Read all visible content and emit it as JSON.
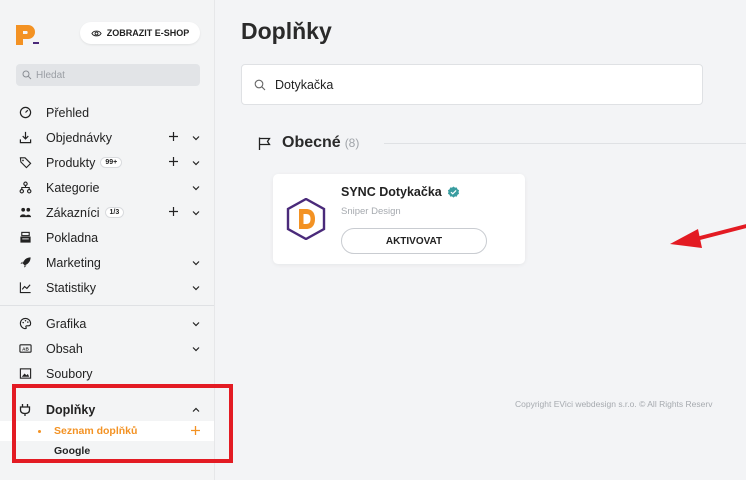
{
  "header": {
    "eshop_button": "ZOBRAZIT E-SHOP",
    "search_placeholder": "Hledat"
  },
  "sidebar": {
    "items": [
      {
        "label": "Přehled"
      },
      {
        "label": "Objednávky"
      },
      {
        "label": "Produkty",
        "badge": "99+"
      },
      {
        "label": "Kategorie"
      },
      {
        "label": "Zákazníci",
        "badge": "1/3"
      },
      {
        "label": "Pokladna"
      },
      {
        "label": "Marketing"
      },
      {
        "label": "Statistiky"
      },
      {
        "label": "Grafika"
      },
      {
        "label": "Obsah"
      },
      {
        "label": "Soubory"
      }
    ],
    "section": {
      "label": "Doplňky",
      "sub_items": [
        {
          "label": "Seznam doplňků"
        },
        {
          "label": "Google"
        }
      ]
    }
  },
  "main": {
    "title": "Doplňky",
    "search_value": "Dotykačka",
    "group": {
      "title": "Obecné",
      "count": "(8)"
    },
    "card": {
      "name": "SYNC Dotykačka",
      "vendor": "Sniper Design",
      "button": "AKTIVOVAT"
    },
    "copyright": "Copyright EVici webdesign s.r.o. © All Rights Reserv"
  },
  "colors": {
    "accent": "#f39223",
    "highlight": "#e31b23",
    "logo_purple": "#4a2a7a",
    "verified": "#3a9da0"
  }
}
